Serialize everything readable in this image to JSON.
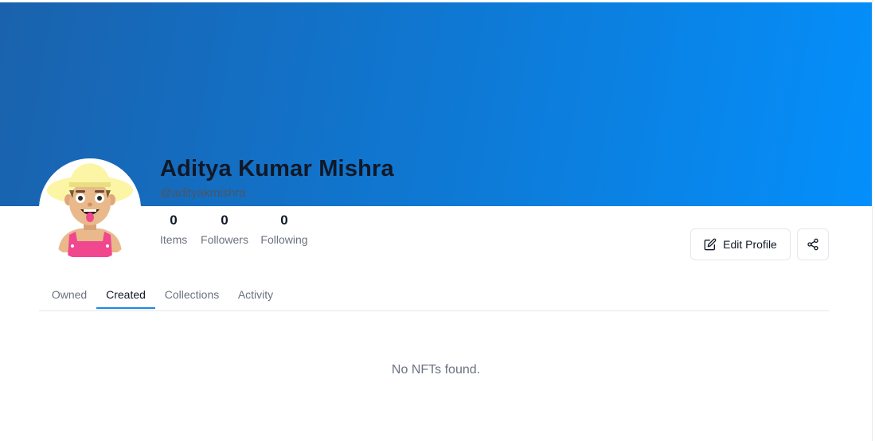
{
  "profile": {
    "name": "Aditya Kumar Mishra",
    "handle": "@adityakmishra"
  },
  "stats": [
    {
      "value": "0",
      "label": "Items"
    },
    {
      "value": "0",
      "label": "Followers"
    },
    {
      "value": "0",
      "label": "Following"
    }
  ],
  "actions": {
    "edit_label": "Edit Profile",
    "edit_icon": "edit-icon",
    "share_icon": "share-icon"
  },
  "tabs": [
    {
      "label": "Owned"
    },
    {
      "label": "Created",
      "active": true
    },
    {
      "label": "Collections"
    },
    {
      "label": "Activity"
    }
  ],
  "content": {
    "empty_message": "No NFTs found."
  },
  "colors": {
    "banner_start": "#1a62ad",
    "banner_end": "#048ffb",
    "tab_active_underline": "#1e88e5"
  }
}
